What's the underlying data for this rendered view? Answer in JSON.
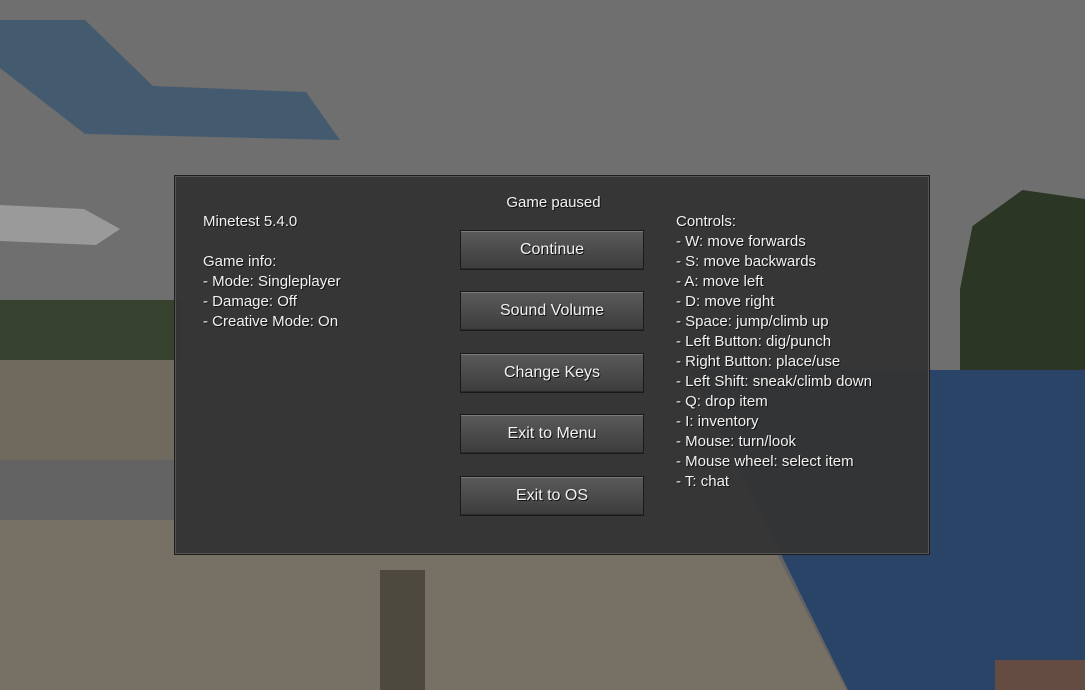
{
  "pause_menu": {
    "title": "Game paused",
    "version": "Minetest 5.4.0",
    "game_info_heading": "Game info:",
    "game_info": [
      "- Mode: Singleplayer",
      "- Damage: Off",
      "- Creative Mode: On"
    ],
    "buttons": {
      "continue": "Continue",
      "sound_volume": "Sound Volume",
      "change_keys": "Change Keys",
      "exit_menu": "Exit to Menu",
      "exit_os": "Exit to OS"
    },
    "controls_heading": "Controls:",
    "controls": [
      "- W: move forwards",
      "- S: move backwards",
      "- A: move left",
      "- D: move right",
      "- Space: jump/climb up",
      "- Left Button: dig/punch",
      "- Right Button: place/use",
      "- Left Shift: sneak/climb down",
      "- Q: drop item",
      "- I: inventory",
      "- Mouse: turn/look",
      "- Mouse wheel: select item",
      "- T: chat"
    ]
  }
}
